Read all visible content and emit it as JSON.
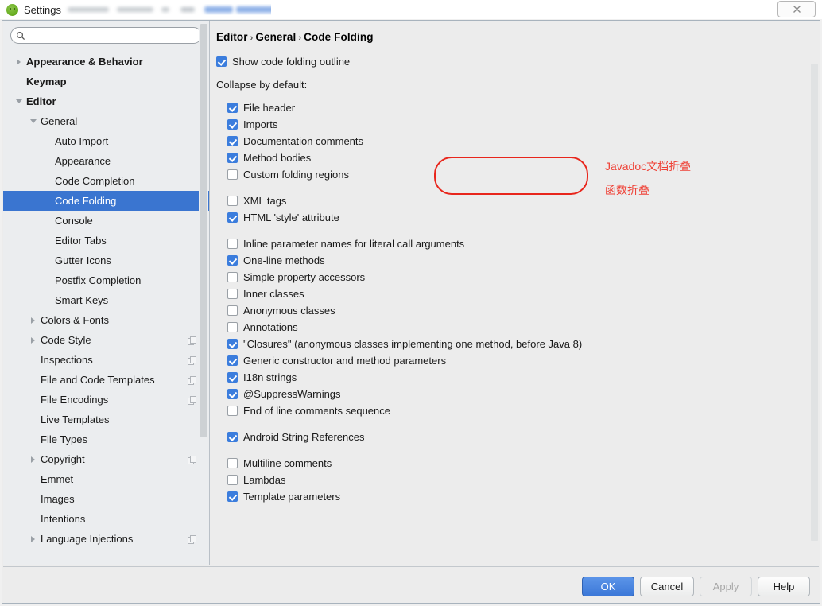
{
  "window": {
    "title": "Settings",
    "app_icon": "android-studio-icon",
    "close_label": "close-icon"
  },
  "search": {
    "placeholder": "",
    "value": "",
    "icon": "search-icon"
  },
  "sidebar": {
    "scrollbar": "vertical-scrollbar",
    "items": [
      {
        "label": "Appearance & Behavior",
        "indent": 0,
        "twisty": "right",
        "bold": true,
        "selected": false,
        "copy_icon": false
      },
      {
        "label": "Keymap",
        "indent": 0,
        "twisty": "none",
        "bold": true,
        "selected": false,
        "copy_icon": false
      },
      {
        "label": "Editor",
        "indent": 0,
        "twisty": "down",
        "bold": true,
        "selected": false,
        "copy_icon": false
      },
      {
        "label": "General",
        "indent": 1,
        "twisty": "down",
        "bold": false,
        "selected": false,
        "copy_icon": false
      },
      {
        "label": "Auto Import",
        "indent": 2,
        "twisty": "none",
        "bold": false,
        "selected": false,
        "copy_icon": false
      },
      {
        "label": "Appearance",
        "indent": 2,
        "twisty": "none",
        "bold": false,
        "selected": false,
        "copy_icon": false
      },
      {
        "label": "Code Completion",
        "indent": 2,
        "twisty": "none",
        "bold": false,
        "selected": false,
        "copy_icon": false
      },
      {
        "label": "Code Folding",
        "indent": 2,
        "twisty": "none",
        "bold": false,
        "selected": true,
        "copy_icon": false
      },
      {
        "label": "Console",
        "indent": 2,
        "twisty": "none",
        "bold": false,
        "selected": false,
        "copy_icon": false
      },
      {
        "label": "Editor Tabs",
        "indent": 2,
        "twisty": "none",
        "bold": false,
        "selected": false,
        "copy_icon": false
      },
      {
        "label": "Gutter Icons",
        "indent": 2,
        "twisty": "none",
        "bold": false,
        "selected": false,
        "copy_icon": false
      },
      {
        "label": "Postfix Completion",
        "indent": 2,
        "twisty": "none",
        "bold": false,
        "selected": false,
        "copy_icon": false
      },
      {
        "label": "Smart Keys",
        "indent": 2,
        "twisty": "none",
        "bold": false,
        "selected": false,
        "copy_icon": false
      },
      {
        "label": "Colors & Fonts",
        "indent": 1,
        "twisty": "right",
        "bold": false,
        "selected": false,
        "copy_icon": false
      },
      {
        "label": "Code Style",
        "indent": 1,
        "twisty": "right",
        "bold": false,
        "selected": false,
        "copy_icon": true
      },
      {
        "label": "Inspections",
        "indent": 1,
        "twisty": "none",
        "bold": false,
        "selected": false,
        "copy_icon": true
      },
      {
        "label": "File and Code Templates",
        "indent": 1,
        "twisty": "none",
        "bold": false,
        "selected": false,
        "copy_icon": true
      },
      {
        "label": "File Encodings",
        "indent": 1,
        "twisty": "none",
        "bold": false,
        "selected": false,
        "copy_icon": true
      },
      {
        "label": "Live Templates",
        "indent": 1,
        "twisty": "none",
        "bold": false,
        "selected": false,
        "copy_icon": false
      },
      {
        "label": "File Types",
        "indent": 1,
        "twisty": "none",
        "bold": false,
        "selected": false,
        "copy_icon": false
      },
      {
        "label": "Copyright",
        "indent": 1,
        "twisty": "right",
        "bold": false,
        "selected": false,
        "copy_icon": true
      },
      {
        "label": "Emmet",
        "indent": 1,
        "twisty": "none",
        "bold": false,
        "selected": false,
        "copy_icon": false
      },
      {
        "label": "Images",
        "indent": 1,
        "twisty": "none",
        "bold": false,
        "selected": false,
        "copy_icon": false
      },
      {
        "label": "Intentions",
        "indent": 1,
        "twisty": "none",
        "bold": false,
        "selected": false,
        "copy_icon": false
      },
      {
        "label": "Language Injections",
        "indent": 1,
        "twisty": "right",
        "bold": false,
        "selected": false,
        "copy_icon": true
      }
    ]
  },
  "breadcrumb": {
    "parts": [
      "Editor",
      "General",
      "Code Folding"
    ],
    "separator": "›"
  },
  "main": {
    "show_outline": {
      "label": "Show code folding outline",
      "checked": true
    },
    "section_label": "Collapse by default:",
    "groups": [
      {
        "indent": true,
        "options": [
          {
            "label": "File header",
            "checked": true
          },
          {
            "label": "Imports",
            "checked": true
          },
          {
            "label": "Documentation comments",
            "checked": true
          },
          {
            "label": "Method bodies",
            "checked": true
          },
          {
            "label": "Custom folding regions",
            "checked": false
          }
        ]
      },
      {
        "indent": true,
        "options": [
          {
            "label": "XML tags",
            "checked": false
          },
          {
            "label": "HTML 'style' attribute",
            "checked": true
          }
        ]
      },
      {
        "indent": true,
        "options": [
          {
            "label": "Inline parameter names for literal call arguments",
            "checked": false
          },
          {
            "label": "One-line methods",
            "checked": true
          },
          {
            "label": "Simple property accessors",
            "checked": false
          },
          {
            "label": "Inner classes",
            "checked": false
          },
          {
            "label": "Anonymous classes",
            "checked": false
          },
          {
            "label": "Annotations",
            "checked": false
          },
          {
            "label": "\"Closures\" (anonymous classes implementing one method, before Java 8)",
            "checked": true
          },
          {
            "label": "Generic constructor and method parameters",
            "checked": true
          },
          {
            "label": "I18n strings",
            "checked": true
          },
          {
            "label": "@SuppressWarnings",
            "checked": true
          },
          {
            "label": "End of line comments sequence",
            "checked": false
          }
        ]
      },
      {
        "indent": true,
        "options": [
          {
            "label": "Android String References",
            "checked": true
          }
        ]
      },
      {
        "indent": true,
        "options": [
          {
            "label": "Multiline comments",
            "checked": false
          },
          {
            "label": "Lambdas",
            "checked": false
          },
          {
            "label": "Template parameters",
            "checked": true
          }
        ]
      }
    ]
  },
  "annotations": {
    "highlight_color": "#e8261c",
    "note_color": "#ef4136",
    "notes": [
      {
        "text": "Javadoc文档折叠"
      },
      {
        "text": "函数折叠"
      }
    ]
  },
  "buttons": {
    "ok": "OK",
    "cancel": "Cancel",
    "apply": "Apply",
    "help": "Help"
  }
}
